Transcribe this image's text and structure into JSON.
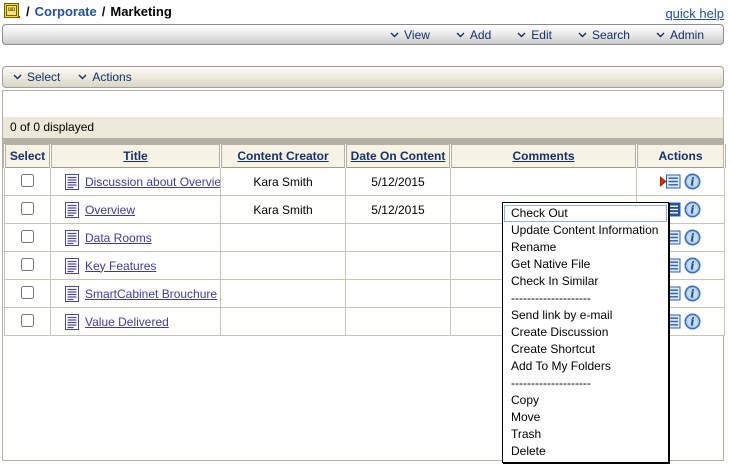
{
  "breadcrumb": {
    "separator": "/",
    "items": [
      {
        "label": "Corporate"
      },
      {
        "label": "Marketing"
      }
    ]
  },
  "quick_help": "quick help",
  "menubar": {
    "items": [
      {
        "label": "View"
      },
      {
        "label": "Add"
      },
      {
        "label": "Edit"
      },
      {
        "label": "Search"
      },
      {
        "label": "Admin"
      }
    ]
  },
  "selection_bar": {
    "items": [
      {
        "label": "Select"
      },
      {
        "label": "Actions"
      }
    ]
  },
  "status": {
    "count_text": "0 of 0 displayed"
  },
  "table": {
    "columns": [
      {
        "label": "Select",
        "sortable": false,
        "interactable": false
      },
      {
        "label": "Title",
        "sortable": true,
        "interactable": true
      },
      {
        "label": "Content Creator",
        "sortable": true,
        "interactable": true
      },
      {
        "label": "Date On Content",
        "sortable": true,
        "interactable": true
      },
      {
        "label": "Comments",
        "sortable": true,
        "interactable": true
      },
      {
        "label": "Actions",
        "sortable": false,
        "interactable": false
      }
    ],
    "rows": [
      {
        "title": "Discussion about Overview",
        "creator": "Kara Smith",
        "date": "5/12/2015",
        "comments": ""
      },
      {
        "title": "Overview",
        "creator": "Kara Smith",
        "date": "5/12/2015",
        "comments": "",
        "menu_open": true
      },
      {
        "title": "Data Rooms",
        "creator": "",
        "date": "",
        "comments": ""
      },
      {
        "title": "Key Features",
        "creator": "",
        "date": "",
        "comments": ""
      },
      {
        "title": "SmartCabinet Brouchure",
        "creator": "",
        "date": "",
        "comments": ""
      },
      {
        "title": "Value Delivered",
        "creator": "",
        "date": "",
        "comments": ""
      }
    ]
  },
  "context_menu": {
    "items": [
      {
        "label": "Check Out",
        "highlighted": true
      },
      {
        "label": "Update Content Information"
      },
      {
        "label": "Rename"
      },
      {
        "label": "Get Native File"
      },
      {
        "label": "Check In Similar"
      },
      {
        "label": "--------------------",
        "separator": true,
        "interactable": false
      },
      {
        "label": "Send link by e-mail"
      },
      {
        "label": "Create Discussion"
      },
      {
        "label": "Create Shortcut"
      },
      {
        "label": "Add To My Folders"
      },
      {
        "label": "--------------------",
        "separator": true,
        "interactable": false
      },
      {
        "label": "Copy"
      },
      {
        "label": "Move"
      },
      {
        "label": "Trash"
      },
      {
        "label": "Delete"
      }
    ]
  },
  "colors": {
    "link_blue": "#3c3c9e",
    "breadcrumb_link": "#24509f",
    "header_text": "#16306b",
    "header_bg": "#f6f3e5",
    "count_bar_bg": "#ece9d8",
    "separator_bar": "#b2b1a4",
    "menu_highlight_border": "#8fb4dd",
    "action_arrow_red": "#d42a00",
    "icon_blue": "#2f5fae",
    "cabinet_yellow": "#f2d73e"
  }
}
